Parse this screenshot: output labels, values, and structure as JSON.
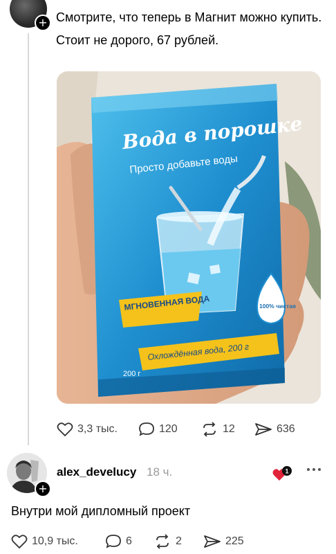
{
  "post": {
    "text_line1": "Смотрите, что теперь в Магнит можно купить.",
    "text_line2": "Стоит не дорого, 67 рублей.",
    "image": {
      "brand_title": "Вода в порошке",
      "tagline": "Просто добавьте воды",
      "badge_left": "МГНОВЕННАЯ ВОДА",
      "badge_right": "100% чистая",
      "ribbon": "Охлождённая вода, 200 г",
      "weight": "200 г"
    },
    "actions": {
      "likes": "3,3 тыс.",
      "comments": "120",
      "reposts": "12",
      "shares": "636"
    }
  },
  "reply": {
    "username": "alex_develucy",
    "time": "18 ч.",
    "notif_count": "1",
    "text": "Внутри мой дипломный проект",
    "actions": {
      "likes": "10,9 тыс.",
      "comments": "6",
      "reposts": "2",
      "shares": "225"
    }
  },
  "colors": {
    "packet_blue": "#1f8fd0",
    "packet_light": "#4fc0ec",
    "ribbon_yellow": "#f4c21b",
    "like_red": "#e0243a"
  }
}
